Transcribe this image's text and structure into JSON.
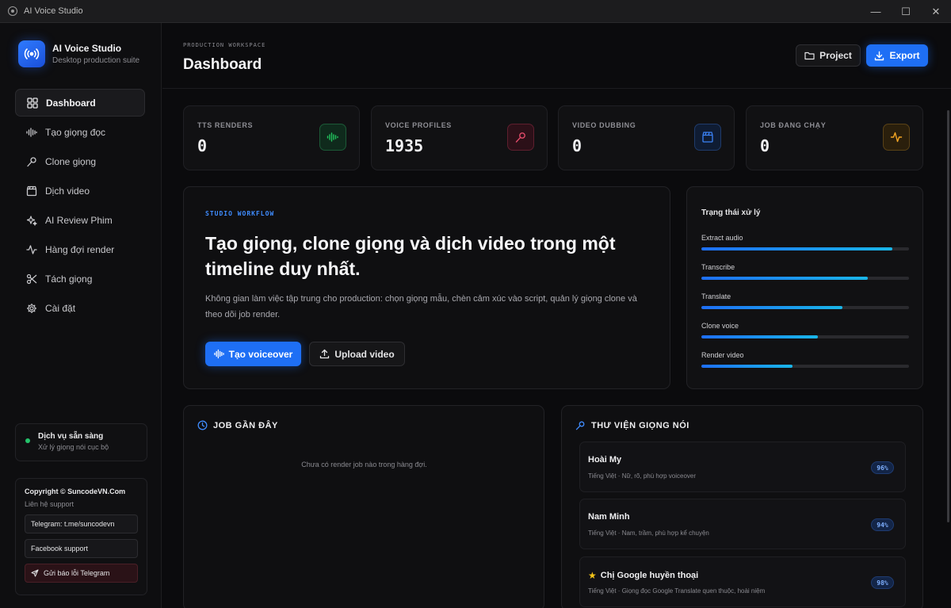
{
  "window": {
    "title": "AI Voice Studio",
    "controls": [
      "—",
      "☐",
      "✕"
    ]
  },
  "brand": {
    "name": "AI Voice Studio",
    "subtitle": "Desktop production suite"
  },
  "sidebar": {
    "items": [
      {
        "label": "Dashboard",
        "icon": "grid-icon",
        "active": true
      },
      {
        "label": "Tạo giọng đọc",
        "icon": "waveform-icon"
      },
      {
        "label": "Clone giọng",
        "icon": "microphone-icon"
      },
      {
        "label": "Dịch video",
        "icon": "clapperboard-icon"
      },
      {
        "label": "AI Review Phim",
        "icon": "sparkles-icon"
      },
      {
        "label": "Hàng đợi render",
        "icon": "activity-icon"
      },
      {
        "label": "Tách giọng",
        "icon": "scissors-icon"
      },
      {
        "label": "Cài đặt",
        "icon": "gear-icon"
      }
    ],
    "status": {
      "title": "Dịch vụ sẵn sàng",
      "subtitle": "Xử lý giọng nói cục bộ",
      "color": "#24c26b"
    },
    "support": {
      "title": "Copyright © SuncodeVN.Com",
      "subtitle": "Liên hệ support",
      "telegram": "Telegram: t.me/suncodevn",
      "facebook": "Facebook support",
      "report": "Gửi báo lỗi Telegram"
    }
  },
  "header": {
    "eyebrow": "PRODUCTION WORKSPACE",
    "title": "Dashboard",
    "project_label": "Project",
    "export_label": "Export"
  },
  "stats": [
    {
      "label": "TTS RENDERS",
      "value": "0",
      "icon": "waveform-icon",
      "color": "#22c55e"
    },
    {
      "label": "VOICE PROFILES",
      "value": "1935",
      "icon": "microphone-icon",
      "color": "#e24b6a"
    },
    {
      "label": "VIDEO DUBBING",
      "value": "0",
      "icon": "clapperboard-icon",
      "color": "#3b82f6"
    },
    {
      "label": "JOB ĐANG CHẠY",
      "value": "0",
      "icon": "activity-icon",
      "color": "#f5a623"
    }
  ],
  "hero": {
    "eyebrow": "STUDIO WORKFLOW",
    "title": "Tạo giọng, clone giọng và dịch video trong một timeline duy nhất.",
    "description": "Không gian làm việc tập trung cho production: chọn giọng mẫu, chèn cảm xúc vào script, quản lý giọng clone và theo dõi job render.",
    "primary_label": "Tạo voiceover",
    "secondary_label": "Upload video"
  },
  "processing": {
    "title": "Trạng thái xử lý",
    "steps": [
      {
        "label": "Extract audio",
        "progress": 0.92
      },
      {
        "label": "Transcribe",
        "progress": 0.8
      },
      {
        "label": "Translate",
        "progress": 0.68
      },
      {
        "label": "Clone voice",
        "progress": 0.56
      },
      {
        "label": "Render video",
        "progress": 0.44
      }
    ]
  },
  "jobs": {
    "title": "JOB GẦN ĐÂY",
    "empty": "Chưa có render job nào trong hàng đợi."
  },
  "library": {
    "title": "THƯ VIỆN GIỌNG NÓI",
    "voices": [
      {
        "name": "Hoài My",
        "desc": "Tiếng Việt · Nữ, rõ, phù hợp voiceover",
        "match": "96%",
        "star": false
      },
      {
        "name": "Nam Minh",
        "desc": "Tiếng Việt · Nam, trầm, phù hợp kể chuyện",
        "match": "94%",
        "star": false
      },
      {
        "name": "Chị Google huyền thoại",
        "desc": "Tiếng Việt · Giọng đọc Google Translate quen thuộc, hoài niệm",
        "match": "98%",
        "star": true
      }
    ]
  },
  "colors": {
    "accent": "#1e6ff5",
    "background": "#0b0b0d"
  }
}
